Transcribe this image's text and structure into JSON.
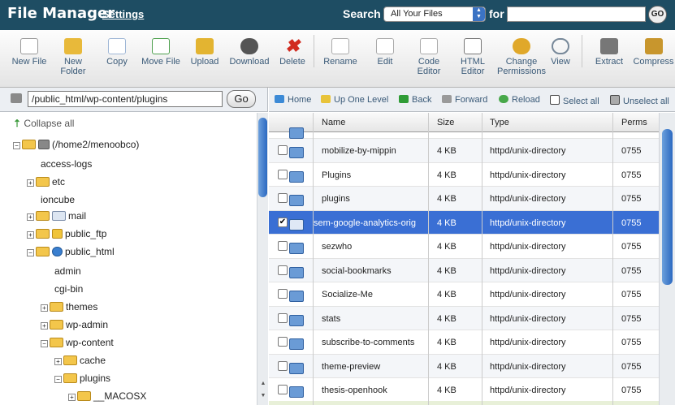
{
  "header": {
    "title": "File Manager",
    "settings": "Settings",
    "search_label": "Search",
    "search_scope": "All Your Files",
    "for_label": "for",
    "search_value": "",
    "go": "GO"
  },
  "toolbar": [
    {
      "label": "New File",
      "icon": "new-file-icon",
      "color": "#5fa83c"
    },
    {
      "label": "New Folder",
      "icon": "new-folder-icon",
      "color": "#e8b93a"
    },
    {
      "label": "Copy",
      "icon": "copy-icon",
      "color": "#9fb7d6"
    },
    {
      "label": "Move File",
      "icon": "move-file-icon",
      "color": "#4da04d"
    },
    {
      "label": "Upload",
      "icon": "upload-icon",
      "color": "#e3b431"
    },
    {
      "label": "Download",
      "icon": "download-icon",
      "color": "#555"
    },
    {
      "label": "Delete",
      "icon": "delete-icon",
      "color": "#d12a1f"
    },
    {
      "label": "Rename",
      "icon": "rename-icon",
      "color": "#c9c9c9"
    },
    {
      "label": "Edit",
      "icon": "edit-icon",
      "color": "#bbb"
    },
    {
      "label": "Code Editor",
      "icon": "code-editor-icon",
      "color": "#ddd"
    },
    {
      "label": "HTML Editor",
      "icon": "html-editor-icon",
      "color": "#ccc"
    },
    {
      "label": "Change Permissions",
      "icon": "key-icon",
      "color": "#e0a82a"
    },
    {
      "label": "View",
      "icon": "magnifier-icon",
      "color": "#9ab"
    },
    {
      "label": "Extract",
      "icon": "extract-icon",
      "color": "#777"
    },
    {
      "label": "Compress",
      "icon": "compress-icon",
      "color": "#c8962d"
    }
  ],
  "path": {
    "value": "/public_html/wp-content/plugins",
    "go": "Go"
  },
  "nav": {
    "home": "Home",
    "up": "Up One Level",
    "back": "Back",
    "forward": "Forward",
    "reload": "Reload",
    "select_all": "Select all",
    "unselect_all": "Unselect all"
  },
  "tree": {
    "collapse": "Collapse all",
    "root": "(/home2/menoobco)",
    "items": [
      "access-logs",
      "etc",
      "ioncube",
      "mail",
      "public_ftp",
      "public_html",
      "admin",
      "cgi-bin",
      "themes",
      "wp-admin",
      "wp-content",
      "cache",
      "plugins",
      "__MACOSX"
    ]
  },
  "table": {
    "headers": {
      "name": "Name",
      "size": "Size",
      "type": "Type",
      "perms": "Perms"
    },
    "rows": [
      {
        "name": "mobilize-by-mippin",
        "size": "4 KB",
        "type": "httpd/unix-directory",
        "perms": "0755"
      },
      {
        "name": "Plugins",
        "size": "4 KB",
        "type": "httpd/unix-directory",
        "perms": "0755"
      },
      {
        "name": "plugins",
        "size": "4 KB",
        "type": "httpd/unix-directory",
        "perms": "0755"
      },
      {
        "name": "sem-google-analytics-orig",
        "size": "4 KB",
        "type": "httpd/unix-directory",
        "perms": "0755"
      },
      {
        "name": "sezwho",
        "size": "4 KB",
        "type": "httpd/unix-directory",
        "perms": "0755"
      },
      {
        "name": "social-bookmarks",
        "size": "4 KB",
        "type": "httpd/unix-directory",
        "perms": "0755"
      },
      {
        "name": "Socialize-Me",
        "size": "4 KB",
        "type": "httpd/unix-directory",
        "perms": "0755"
      },
      {
        "name": "stats",
        "size": "4 KB",
        "type": "httpd/unix-directory",
        "perms": "0755"
      },
      {
        "name": "subscribe-to-comments",
        "size": "4 KB",
        "type": "httpd/unix-directory",
        "perms": "0755"
      },
      {
        "name": "theme-preview",
        "size": "4 KB",
        "type": "httpd/unix-directory",
        "perms": "0755"
      },
      {
        "name": "thesis-openhook",
        "size": "4 KB",
        "type": "httpd/unix-directory",
        "perms": "0755"
      }
    ]
  }
}
